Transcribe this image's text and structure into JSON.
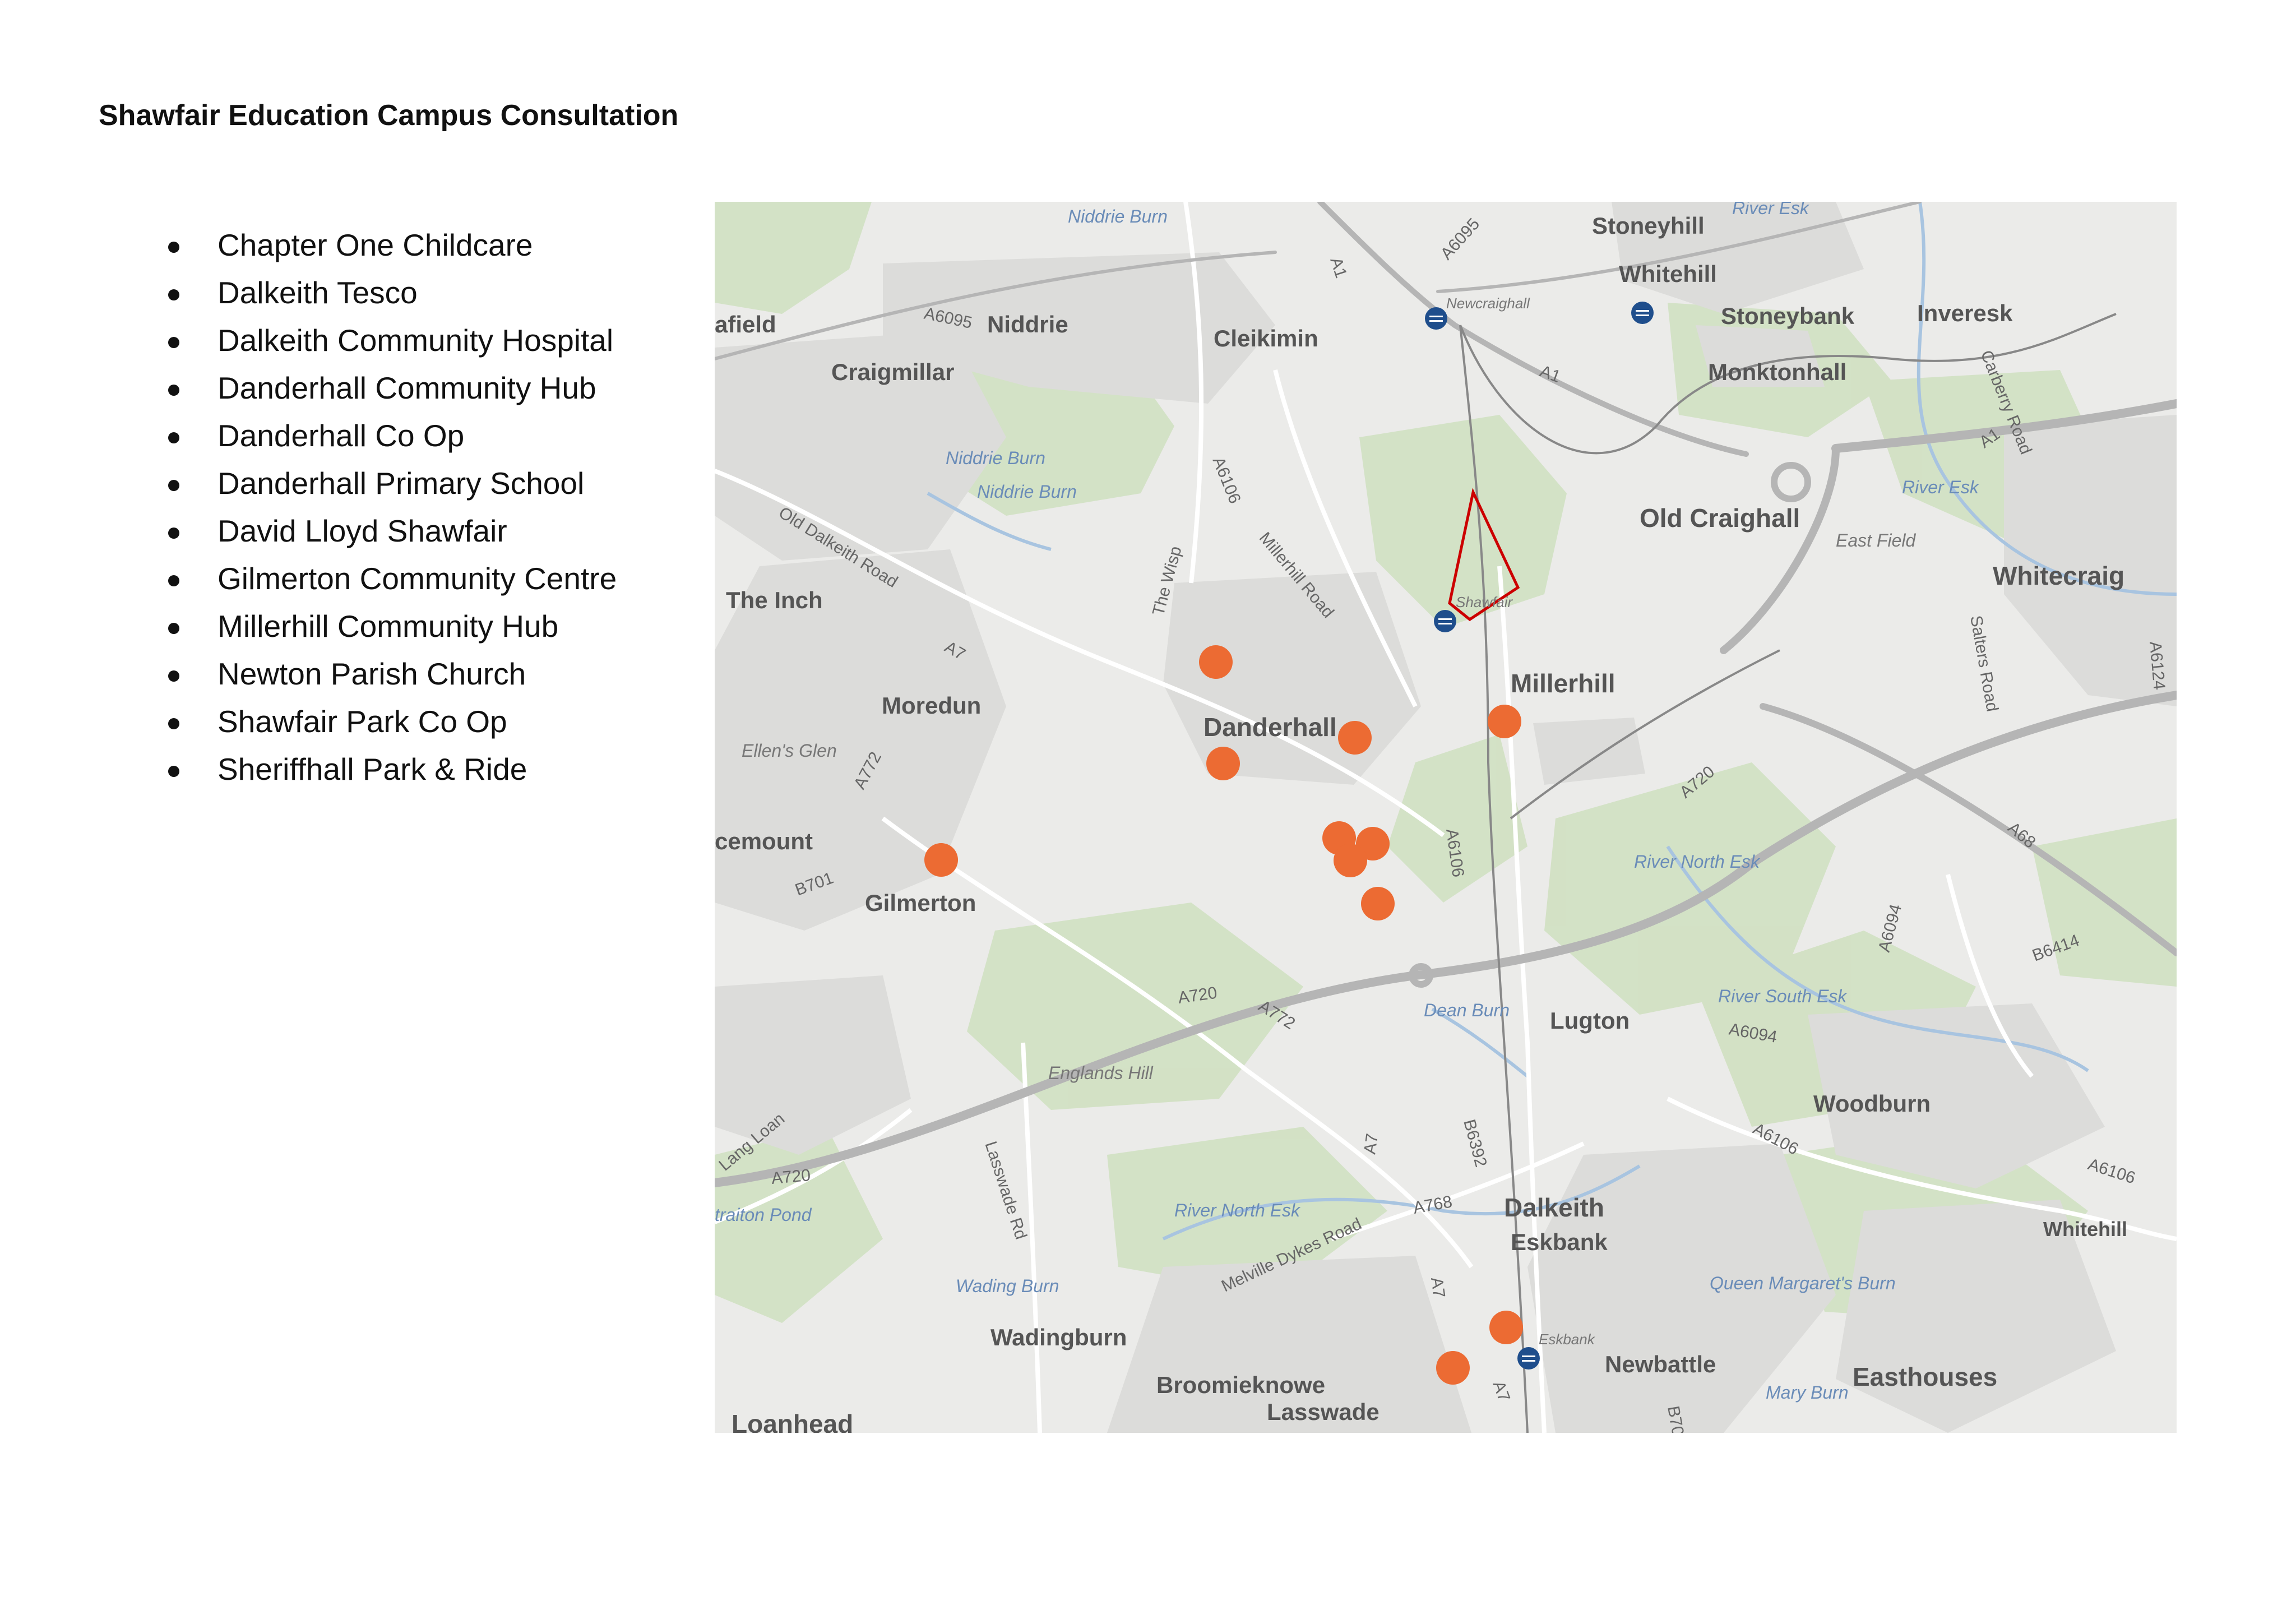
{
  "title": "Shawfair Education Campus Consultation",
  "venues": [
    "Chapter One Childcare",
    "Dalkeith Tesco",
    "Dalkeith Community Hospital",
    "Danderhall Community Hub",
    "Danderhall Co Op",
    "Danderhall Primary School",
    "David Lloyd Shawfair",
    "Gilmerton Community Centre",
    "Millerhill Community Hub",
    "Newton Parish Church",
    "Shawfair Park Co Op",
    "Sheriffhall Park & Ride"
  ],
  "map": {
    "colors": {
      "background": "#ebebe9",
      "green": "#cfe0bf",
      "water": "#a8c4e0",
      "road_major": "#b5b5b5",
      "road_minor": "#ffffff",
      "boundary": "#cc0000",
      "marker": "#ec6b33",
      "station": "#1f4e8c"
    },
    "places": [
      {
        "name": "Stoneyhill",
        "size": "m"
      },
      {
        "name": "Whitehill",
        "size": "m"
      },
      {
        "name": "Stoneybank",
        "size": "m"
      },
      {
        "name": "Inveresk",
        "size": "m"
      },
      {
        "name": "Monktonhall",
        "size": "m"
      },
      {
        "name": "Old Craighall",
        "size": "l"
      },
      {
        "name": "Whitecraig",
        "size": "l"
      },
      {
        "name": "Niddrie",
        "size": "m"
      },
      {
        "name": "Cleikimin",
        "size": "m"
      },
      {
        "name": "Craigmillar",
        "size": "m"
      },
      {
        "name": "afield",
        "size": "m"
      },
      {
        "name": "The Inch",
        "size": "m"
      },
      {
        "name": "Moredun",
        "size": "m"
      },
      {
        "name": "Danderhall",
        "size": "l"
      },
      {
        "name": "Millerhill",
        "size": "l"
      },
      {
        "name": "cemount",
        "size": "m"
      },
      {
        "name": "Gilmerton",
        "size": "m"
      },
      {
        "name": "Lugton",
        "size": "m"
      },
      {
        "name": "Woodburn",
        "size": "m"
      },
      {
        "name": "Dalkeith",
        "size": "l"
      },
      {
        "name": "Eskbank",
        "size": "m"
      },
      {
        "name": "Wadingburn",
        "size": "m"
      },
      {
        "name": "Broomieknowe",
        "size": "m"
      },
      {
        "name": "Lasswade",
        "size": "m"
      },
      {
        "name": "Newbattle",
        "size": "m"
      },
      {
        "name": "Easthouses",
        "size": "l"
      },
      {
        "name": "Loanhead",
        "size": "l"
      },
      {
        "name": "Whitehill",
        "size": "s"
      }
    ],
    "minor_places": [
      "East Field",
      "Ellen's Glen",
      "Englands Hill",
      "Newcraighall",
      "Shawfair",
      "Eskbank"
    ],
    "water_labels": [
      "Niddrie Burn",
      "River Esk",
      "Niddrie Burn",
      "Niddrie Burn",
      "River Esk",
      "River North Esk",
      "River South Esk",
      "Dean Burn",
      "River North Esk",
      "Wading Burn",
      "Queen Margaret's Burn",
      "Mary Burn",
      "traiton Pond"
    ],
    "road_labels": [
      "A1",
      "A6095",
      "A6095",
      "A1",
      "A1",
      "Carberry Road",
      "A6106",
      "Millerhill Road",
      "The Wisp",
      "Old Dalkeith Road",
      "A7",
      "A772",
      "B701",
      "A720",
      "A6106",
      "Salters Road",
      "A6124",
      "A68",
      "A6094",
      "B6414",
      "A6094",
      "A6106",
      "A6106",
      "A720",
      "A772",
      "A720",
      "Lang Loan",
      "Lasswade Rd",
      "A7",
      "B6392",
      "A768",
      "Melville Dykes Road",
      "A7",
      "A7",
      "B70"
    ],
    "marker_count": 12,
    "station_icons": [
      "station-icon",
      "station-icon",
      "station-icon",
      "station-icon"
    ]
  }
}
